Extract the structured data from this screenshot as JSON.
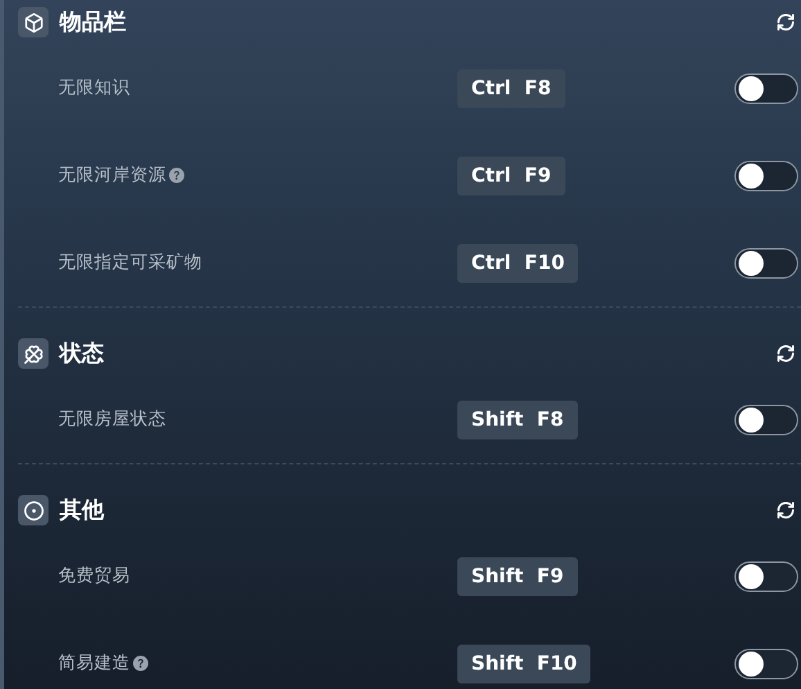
{
  "sections": [
    {
      "title": "物品栏",
      "rows": [
        {
          "label": "无限知识",
          "help": false,
          "hotkey": "Ctrl  F8",
          "on": false
        },
        {
          "label": "无限河岸资源",
          "help": true,
          "hotkey": "Ctrl  F9",
          "on": false
        },
        {
          "label": "无限指定可采矿物",
          "help": false,
          "hotkey": "Ctrl  F10",
          "on": false
        }
      ]
    },
    {
      "title": "状态",
      "rows": [
        {
          "label": "无限房屋状态",
          "help": false,
          "hotkey": "Shift  F8",
          "on": false
        }
      ]
    },
    {
      "title": "其他",
      "rows": [
        {
          "label": "免费贸易",
          "help": false,
          "hotkey": "Shift  F9",
          "on": false
        },
        {
          "label": "简易建造",
          "help": true,
          "hotkey": "Shift  F10",
          "on": false
        }
      ]
    }
  ]
}
